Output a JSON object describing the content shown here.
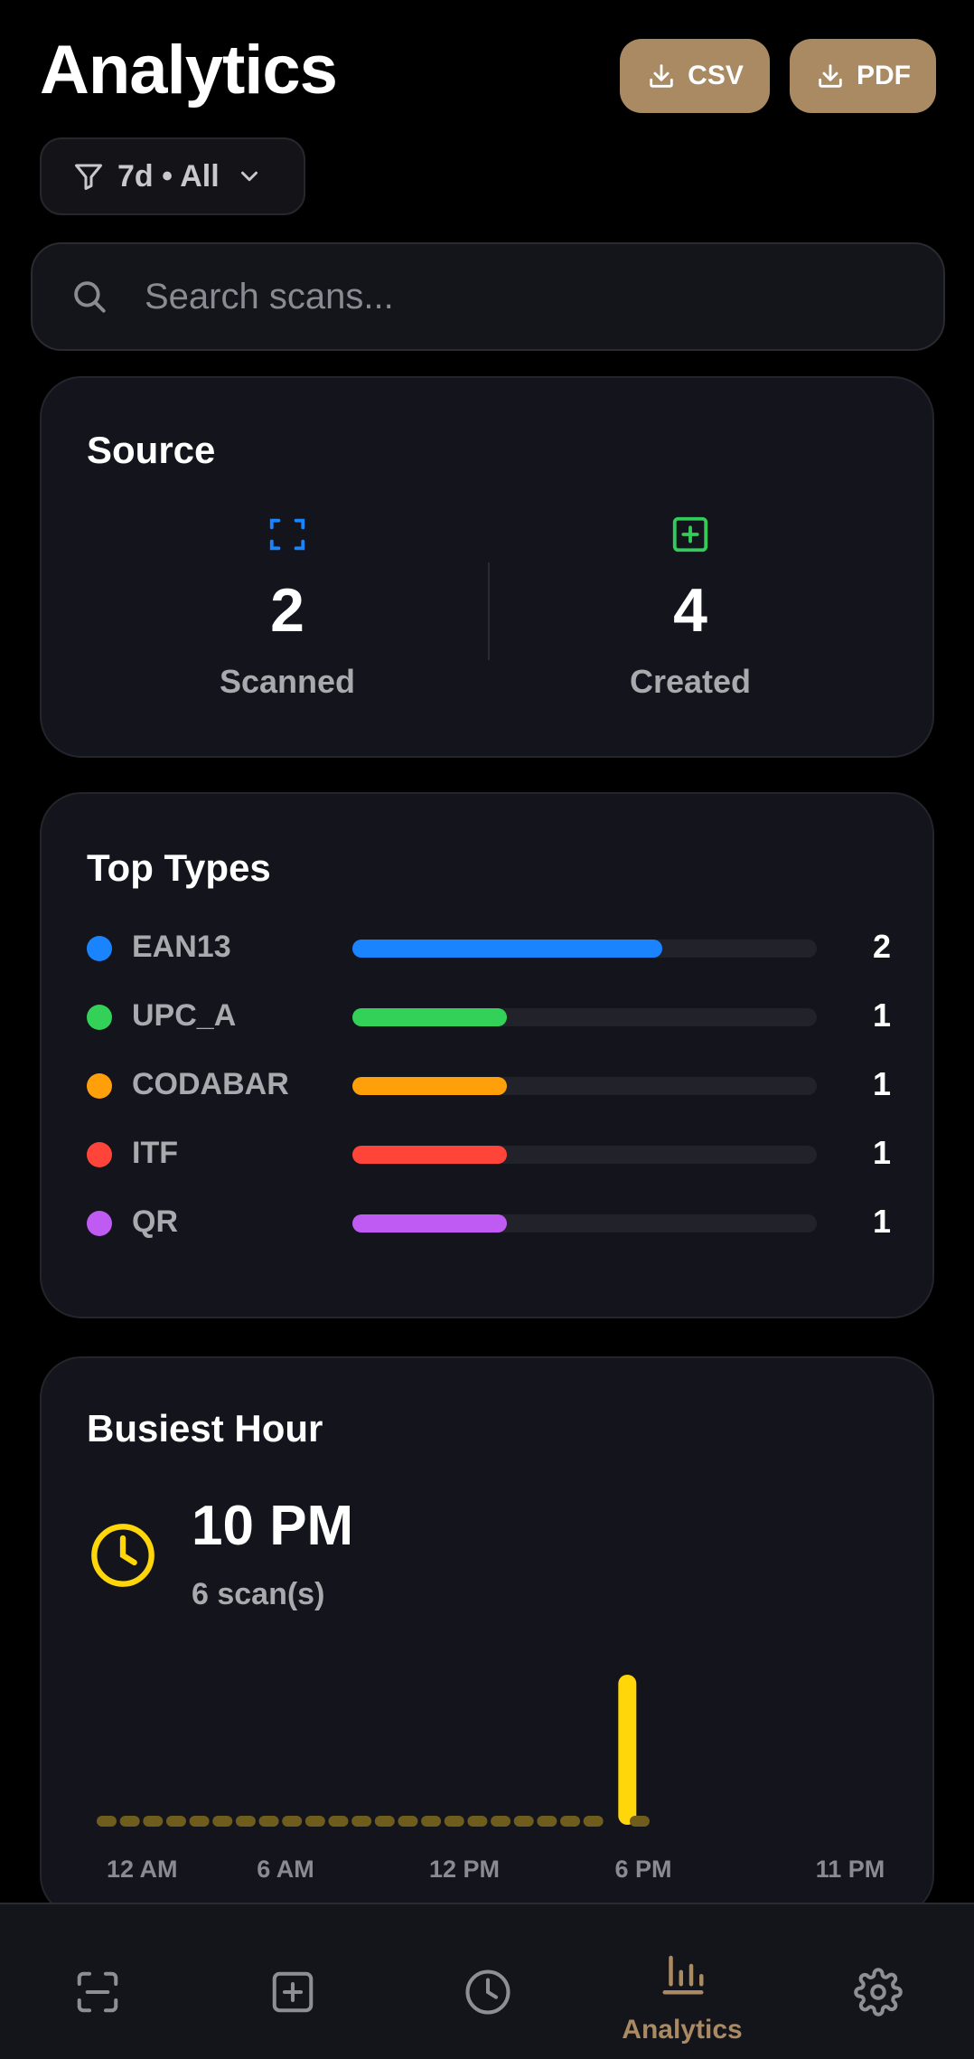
{
  "header": {
    "title": "Analytics",
    "csv_label": "CSV",
    "pdf_label": "PDF",
    "filter_label": "7d • All"
  },
  "search": {
    "placeholder": "Search scans..."
  },
  "source": {
    "title": "Source",
    "scanned": {
      "count": "2",
      "label": "Scanned",
      "icon": "scan-frame-icon",
      "color": "#1a84ff"
    },
    "created": {
      "count": "4",
      "label": "Created",
      "icon": "plus-square-icon",
      "color": "#33cc5a"
    }
  },
  "top_types": {
    "title": "Top Types",
    "max": 3,
    "items": [
      {
        "label": "EAN13",
        "count": "2",
        "value": 2,
        "color": "#1a84ff"
      },
      {
        "label": "UPC_A",
        "count": "1",
        "value": 1,
        "color": "#33d158"
      },
      {
        "label": "CODABAR",
        "count": "1",
        "value": 1,
        "color": "#ff9f0a"
      },
      {
        "label": "ITF",
        "count": "1",
        "value": 1,
        "color": "#ff453a"
      },
      {
        "label": "QR",
        "count": "1",
        "value": 1,
        "color": "#bf5af2"
      }
    ]
  },
  "busiest_hour": {
    "title": "Busiest Hour",
    "hour": "10 PM",
    "count_text": "6 scan(s)",
    "accent": "#ffd60a"
  },
  "chart_data": {
    "type": "bar",
    "categories": [
      "0",
      "1",
      "2",
      "3",
      "4",
      "5",
      "6",
      "7",
      "8",
      "9",
      "10",
      "11",
      "12",
      "13",
      "14",
      "15",
      "16",
      "17",
      "18",
      "19",
      "20",
      "21",
      "22",
      "23"
    ],
    "values": [
      0,
      0,
      0,
      0,
      0,
      0,
      0,
      0,
      0,
      0,
      0,
      0,
      0,
      0,
      0,
      0,
      0,
      0,
      0,
      0,
      0,
      0,
      6,
      0
    ],
    "tick_labels": [
      "12 AM",
      "6 AM",
      "12 PM",
      "6 PM",
      "11 PM"
    ],
    "tick_indices": [
      0,
      6,
      12,
      18,
      23
    ],
    "color": "#ffd60a",
    "ylim": [
      0,
      6
    ]
  },
  "nav": {
    "items": [
      {
        "name": "nav-scan",
        "icon": "scan-icon",
        "label": ""
      },
      {
        "name": "nav-create",
        "icon": "plus-square-icon",
        "label": ""
      },
      {
        "name": "nav-history",
        "icon": "clock-icon",
        "label": ""
      },
      {
        "name": "nav-analytics",
        "icon": "bar-chart-icon",
        "label": "Analytics",
        "active": true
      },
      {
        "name": "nav-settings",
        "icon": "gear-icon",
        "label": ""
      }
    ],
    "active_color": "#a98a63",
    "inactive_color": "#8e8e94"
  }
}
